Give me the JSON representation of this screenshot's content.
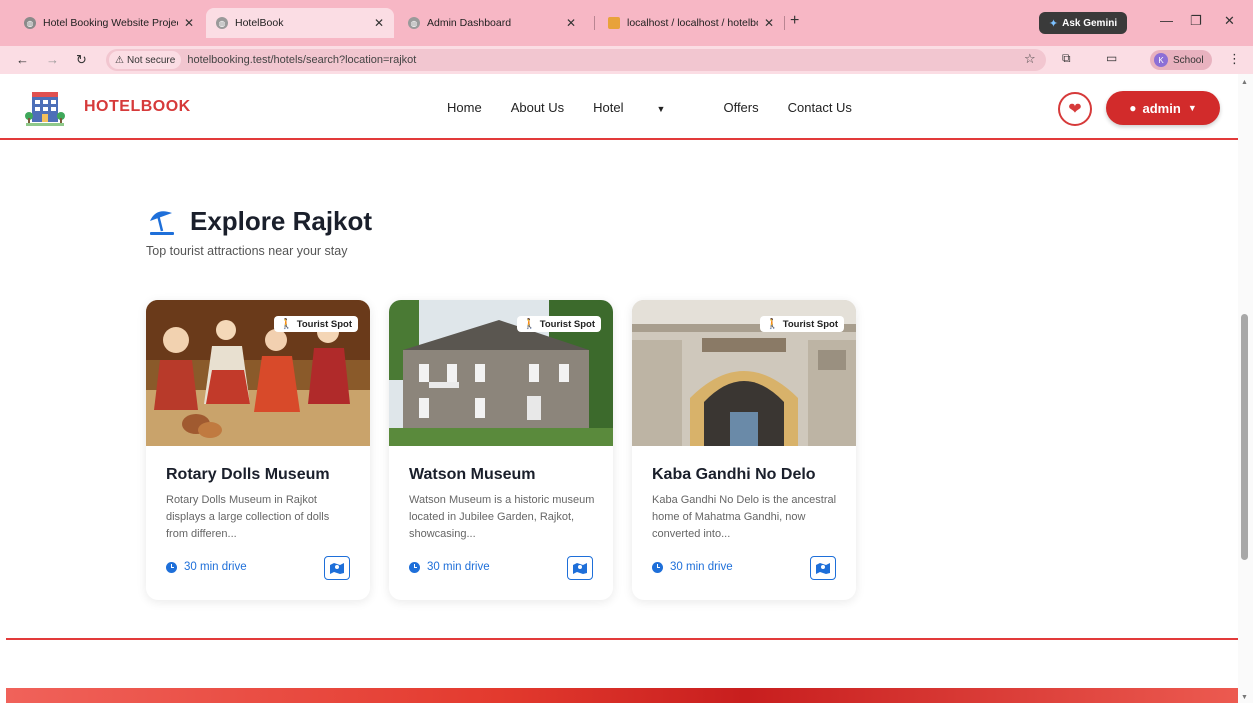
{
  "browser": {
    "tabs": [
      {
        "title": "Hotel Booking Website Project"
      },
      {
        "title": "HotelBook"
      },
      {
        "title": "Admin Dashboard"
      },
      {
        "title": "localhost / localhost / hotelboo"
      }
    ],
    "gemini_label": "Ask Gemini",
    "security_label": "Not secure",
    "url": "hotelbooking.test/hotels/search?location=rajkot",
    "profile_label": "School",
    "profile_initial": "K"
  },
  "header": {
    "brand": "HOTELBOOK",
    "nav": {
      "home": "Home",
      "about": "About Us",
      "hotel": "Hotel",
      "offers": "Offers",
      "contact": "Contact Us"
    },
    "user_label": "admin"
  },
  "section": {
    "title": "Explore Rajkot",
    "subtitle": "Top tourist attractions near your stay"
  },
  "cards": [
    {
      "badge": "Tourist Spot",
      "title": "Rotary Dolls Museum",
      "description": "Rotary Dolls Museum in Rajkot displays a large collection of dolls from differen...",
      "time": "30 min drive"
    },
    {
      "badge": "Tourist Spot",
      "title": "Watson Museum",
      "description": "Watson Museum is a historic museum located in Jubilee Garden, Rajkot, showcasing...",
      "time": "30 min drive"
    },
    {
      "badge": "Tourist Spot",
      "title": "Kaba Gandhi No Delo",
      "description": "Kaba Gandhi No Delo is the ancestral home of Mahatma Gandhi, now converted into...",
      "time": "30 min drive"
    }
  ],
  "colors": {
    "brand": "#d63a3a",
    "accent_blue": "#1e6fd9",
    "tabbar": "#f7b7c5"
  }
}
